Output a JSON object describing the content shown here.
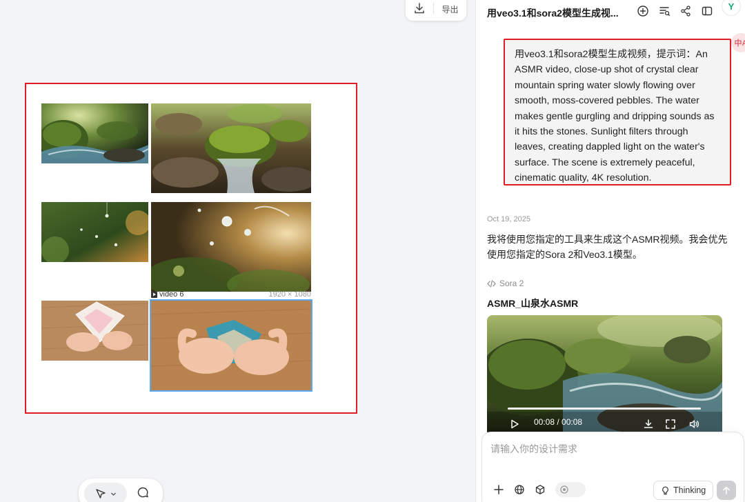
{
  "canvas": {
    "toolbar": {
      "export_label": "导出"
    },
    "tile_meta": {
      "name": "video 6",
      "dimensions": "1920 × 1080"
    }
  },
  "panel": {
    "title": "用veo3.1和sora2模型生成视...",
    "avatar_letter": "Y",
    "translate_label": "中A",
    "prompt": "用veo3.1和sora2模型生成视频，提示词：An ASMR video, close-up shot of crystal clear mountain spring water slowly flowing over smooth, moss-covered pebbles. The water makes gentle gurgling and dripping sounds as it hits the stones. Sunlight filters through leaves, creating dappled light on the water's surface. The scene is extremely peaceful, cinematic quality, 4K resolution.",
    "message": {
      "date": "Oct 19, 2025",
      "text": "我将使用您指定的工具来生成这个ASMR视频。我会优先使用您指定的Sora 2和Veo3.1模型。",
      "tool_name": "Sora 2",
      "video_title": "ASMR_山泉水ASMR",
      "video_time": "00:08 / 00:08",
      "video_progress": 1.0
    },
    "composer": {
      "placeholder": "请输入你的设计需求",
      "thinking_label": "Thinking"
    }
  },
  "colors": {
    "selection_red": "#e01b24",
    "selection_blue": "#59a8f0",
    "brand_green": "#1ea672"
  }
}
